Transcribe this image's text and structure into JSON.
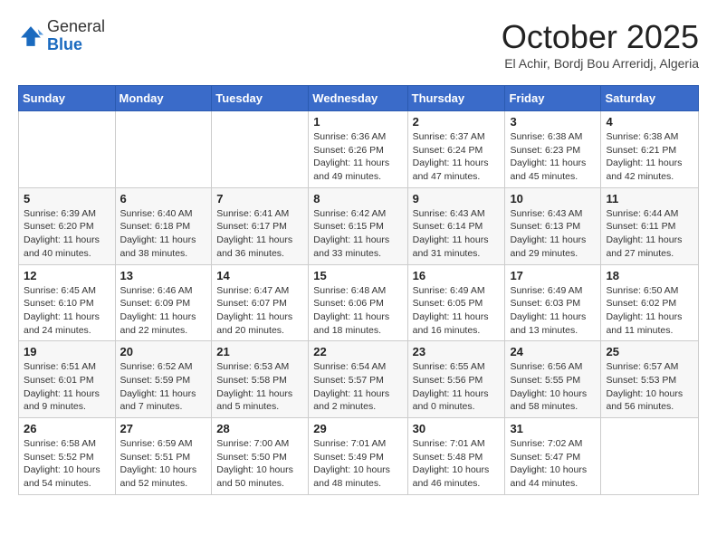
{
  "header": {
    "logo_general": "General",
    "logo_blue": "Blue",
    "month": "October 2025",
    "location": "El Achir, Bordj Bou Arreridj, Algeria"
  },
  "days_of_week": [
    "Sunday",
    "Monday",
    "Tuesday",
    "Wednesday",
    "Thursday",
    "Friday",
    "Saturday"
  ],
  "weeks": [
    [
      {
        "day": "",
        "detail": ""
      },
      {
        "day": "",
        "detail": ""
      },
      {
        "day": "",
        "detail": ""
      },
      {
        "day": "1",
        "detail": "Sunrise: 6:36 AM\nSunset: 6:26 PM\nDaylight: 11 hours and 49 minutes."
      },
      {
        "day": "2",
        "detail": "Sunrise: 6:37 AM\nSunset: 6:24 PM\nDaylight: 11 hours and 47 minutes."
      },
      {
        "day": "3",
        "detail": "Sunrise: 6:38 AM\nSunset: 6:23 PM\nDaylight: 11 hours and 45 minutes."
      },
      {
        "day": "4",
        "detail": "Sunrise: 6:38 AM\nSunset: 6:21 PM\nDaylight: 11 hours and 42 minutes."
      }
    ],
    [
      {
        "day": "5",
        "detail": "Sunrise: 6:39 AM\nSunset: 6:20 PM\nDaylight: 11 hours and 40 minutes."
      },
      {
        "day": "6",
        "detail": "Sunrise: 6:40 AM\nSunset: 6:18 PM\nDaylight: 11 hours and 38 minutes."
      },
      {
        "day": "7",
        "detail": "Sunrise: 6:41 AM\nSunset: 6:17 PM\nDaylight: 11 hours and 36 minutes."
      },
      {
        "day": "8",
        "detail": "Sunrise: 6:42 AM\nSunset: 6:15 PM\nDaylight: 11 hours and 33 minutes."
      },
      {
        "day": "9",
        "detail": "Sunrise: 6:43 AM\nSunset: 6:14 PM\nDaylight: 11 hours and 31 minutes."
      },
      {
        "day": "10",
        "detail": "Sunrise: 6:43 AM\nSunset: 6:13 PM\nDaylight: 11 hours and 29 minutes."
      },
      {
        "day": "11",
        "detail": "Sunrise: 6:44 AM\nSunset: 6:11 PM\nDaylight: 11 hours and 27 minutes."
      }
    ],
    [
      {
        "day": "12",
        "detail": "Sunrise: 6:45 AM\nSunset: 6:10 PM\nDaylight: 11 hours and 24 minutes."
      },
      {
        "day": "13",
        "detail": "Sunrise: 6:46 AM\nSunset: 6:09 PM\nDaylight: 11 hours and 22 minutes."
      },
      {
        "day": "14",
        "detail": "Sunrise: 6:47 AM\nSunset: 6:07 PM\nDaylight: 11 hours and 20 minutes."
      },
      {
        "day": "15",
        "detail": "Sunrise: 6:48 AM\nSunset: 6:06 PM\nDaylight: 11 hours and 18 minutes."
      },
      {
        "day": "16",
        "detail": "Sunrise: 6:49 AM\nSunset: 6:05 PM\nDaylight: 11 hours and 16 minutes."
      },
      {
        "day": "17",
        "detail": "Sunrise: 6:49 AM\nSunset: 6:03 PM\nDaylight: 11 hours and 13 minutes."
      },
      {
        "day": "18",
        "detail": "Sunrise: 6:50 AM\nSunset: 6:02 PM\nDaylight: 11 hours and 11 minutes."
      }
    ],
    [
      {
        "day": "19",
        "detail": "Sunrise: 6:51 AM\nSunset: 6:01 PM\nDaylight: 11 hours and 9 minutes."
      },
      {
        "day": "20",
        "detail": "Sunrise: 6:52 AM\nSunset: 5:59 PM\nDaylight: 11 hours and 7 minutes."
      },
      {
        "day": "21",
        "detail": "Sunrise: 6:53 AM\nSunset: 5:58 PM\nDaylight: 11 hours and 5 minutes."
      },
      {
        "day": "22",
        "detail": "Sunrise: 6:54 AM\nSunset: 5:57 PM\nDaylight: 11 hours and 2 minutes."
      },
      {
        "day": "23",
        "detail": "Sunrise: 6:55 AM\nSunset: 5:56 PM\nDaylight: 11 hours and 0 minutes."
      },
      {
        "day": "24",
        "detail": "Sunrise: 6:56 AM\nSunset: 5:55 PM\nDaylight: 10 hours and 58 minutes."
      },
      {
        "day": "25",
        "detail": "Sunrise: 6:57 AM\nSunset: 5:53 PM\nDaylight: 10 hours and 56 minutes."
      }
    ],
    [
      {
        "day": "26",
        "detail": "Sunrise: 6:58 AM\nSunset: 5:52 PM\nDaylight: 10 hours and 54 minutes."
      },
      {
        "day": "27",
        "detail": "Sunrise: 6:59 AM\nSunset: 5:51 PM\nDaylight: 10 hours and 52 minutes."
      },
      {
        "day": "28",
        "detail": "Sunrise: 7:00 AM\nSunset: 5:50 PM\nDaylight: 10 hours and 50 minutes."
      },
      {
        "day": "29",
        "detail": "Sunrise: 7:01 AM\nSunset: 5:49 PM\nDaylight: 10 hours and 48 minutes."
      },
      {
        "day": "30",
        "detail": "Sunrise: 7:01 AM\nSunset: 5:48 PM\nDaylight: 10 hours and 46 minutes."
      },
      {
        "day": "31",
        "detail": "Sunrise: 7:02 AM\nSunset: 5:47 PM\nDaylight: 10 hours and 44 minutes."
      },
      {
        "day": "",
        "detail": ""
      }
    ]
  ]
}
